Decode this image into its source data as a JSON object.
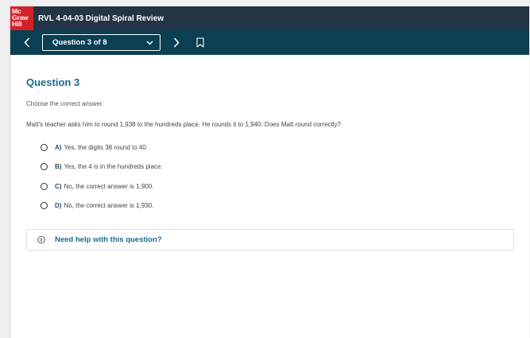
{
  "header": {
    "logo_lines": [
      "Mc",
      "Graw",
      "Hill"
    ],
    "title": "RVL 4-04-03 Digital Spiral Review"
  },
  "nav": {
    "question_selector": "Question 3 of 8"
  },
  "question": {
    "title": "Question 3",
    "instruction": "Choose the correct answer.",
    "prompt": "Matt's teacher asks him to round 1,938 to the hundreds place. He rounds it to 1,940. Does Matt round correctly?",
    "options": [
      {
        "letter": "A)",
        "text": "Yes, the digits 38 round to 40."
      },
      {
        "letter": "B)",
        "text": "Yes, the 4 is in the hundreds place."
      },
      {
        "letter": "C)",
        "text": "No, the correct answer is 1,900."
      },
      {
        "letter": "D)",
        "text": "No, the correct answer is 1,930."
      }
    ]
  },
  "help": {
    "label": "Need help with this question?"
  },
  "colors": {
    "header_bg": "#243447",
    "subnav_bg": "#0b3f52",
    "logo_red": "#d2232a",
    "accent_teal": "#1b6c8a"
  },
  "icons": {
    "prev": "chevron-left-icon",
    "next": "chevron-right-icon",
    "dropdown": "chevron-down-icon",
    "bookmark": "bookmark-icon",
    "help": "circle-chevron-right-icon"
  }
}
